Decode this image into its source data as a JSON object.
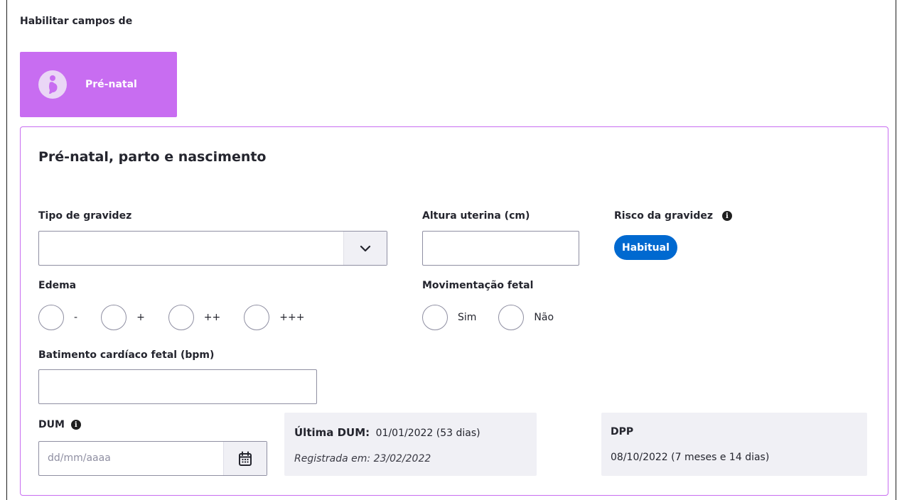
{
  "header": {
    "enable_fields_label": "Habilitar campos de"
  },
  "toggle": {
    "label": "Pré-natal",
    "color": "#c86df1"
  },
  "panel": {
    "title": "Pré-natal, parto e nascimento"
  },
  "fields": {
    "tipo_gravidez": {
      "label": "Tipo de gravidez",
      "value": ""
    },
    "altura_uterina": {
      "label": "Altura uterina (cm)",
      "value": ""
    },
    "risco_gravidez": {
      "label": "Risco da gravidez",
      "badge": "Habitual",
      "badge_color": "#0069d0"
    },
    "edema": {
      "label": "Edema",
      "options": [
        "-",
        "+",
        "++",
        "+++"
      ]
    },
    "movimentacao_fetal": {
      "label": "Movimentação fetal",
      "options": [
        "Sim",
        "Não"
      ]
    },
    "batimento": {
      "label": "Batimento cardíaco fetal (bpm)",
      "value": ""
    },
    "dum": {
      "label": "DUM",
      "placeholder": "dd/mm/aaaa"
    }
  },
  "ultima_dum": {
    "label": "Última DUM:",
    "value": "01/01/2022 (53 dias)",
    "registered": "Registrada em: 23/02/2022"
  },
  "dpp": {
    "label": "DPP",
    "value": "08/10/2022 (7 meses e 14 dias)"
  }
}
